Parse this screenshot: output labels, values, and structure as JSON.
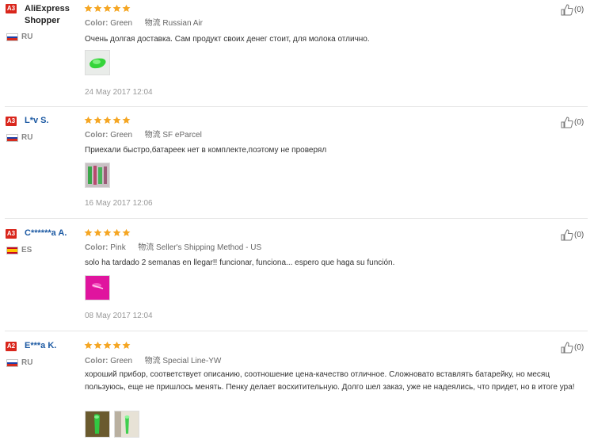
{
  "reviews": [
    {
      "badge": "A3",
      "name": "AliExpress Shopper",
      "country": "RU",
      "color_label": "Color:",
      "color_value": "Green",
      "shipping_label": "物流",
      "shipping_value": "Russian Air",
      "text": "Очень долгая доставка. Сам продукт своих денег стоит, для молока отлично.",
      "date": "24 May 2017 12:04",
      "helpful": "(0)",
      "rating": 5
    },
    {
      "badge": "A3",
      "name": "L*v S.",
      "country": "RU",
      "color_label": "Color:",
      "color_value": "Green",
      "shipping_label": "物流",
      "shipping_value": "SF eParcel",
      "text": "Приехали быстро,батареек нет в комплекте,поэтому не проверял",
      "date": "16 May 2017 12:06",
      "helpful": "(0)",
      "rating": 5
    },
    {
      "badge": "A3",
      "name": "C******a A.",
      "country": "ES",
      "color_label": "Color:",
      "color_value": "Pink",
      "shipping_label": "物流",
      "shipping_value": "Seller's Shipping Method - US",
      "text": "solo ha tardado 2 semanas en llegar!! funcionar, funciona... espero que haga su función.",
      "date": "08 May 2017 12:04",
      "helpful": "(0)",
      "rating": 5
    },
    {
      "badge": "A2",
      "name": "E***a K.",
      "country": "RU",
      "color_label": "Color:",
      "color_value": "Green",
      "shipping_label": "物流",
      "shipping_value": "Special Line-YW",
      "text": "хороший прибор, соответствует описанию, соотношение цена-качество отличное. Сложновато вставлять батарейку, но месяц пользуюсь, еще не пришлось менять. Пенку делает восхитительную. Долго шел заказ, уже не надеялись, что придет, но в итоге ура!",
      "date": "",
      "helpful": "(0)",
      "rating": 5
    }
  ],
  "colors": {
    "badge": "#d9261c",
    "star": "#f5a623",
    "link": "#1d5aa3",
    "divider": "#e6e6e6"
  },
  "icons": {
    "star": "star-icon",
    "helpful": "thumbs-up-icon",
    "flag_ru": "russia-flag-icon",
    "flag_es": "spain-flag-icon"
  }
}
